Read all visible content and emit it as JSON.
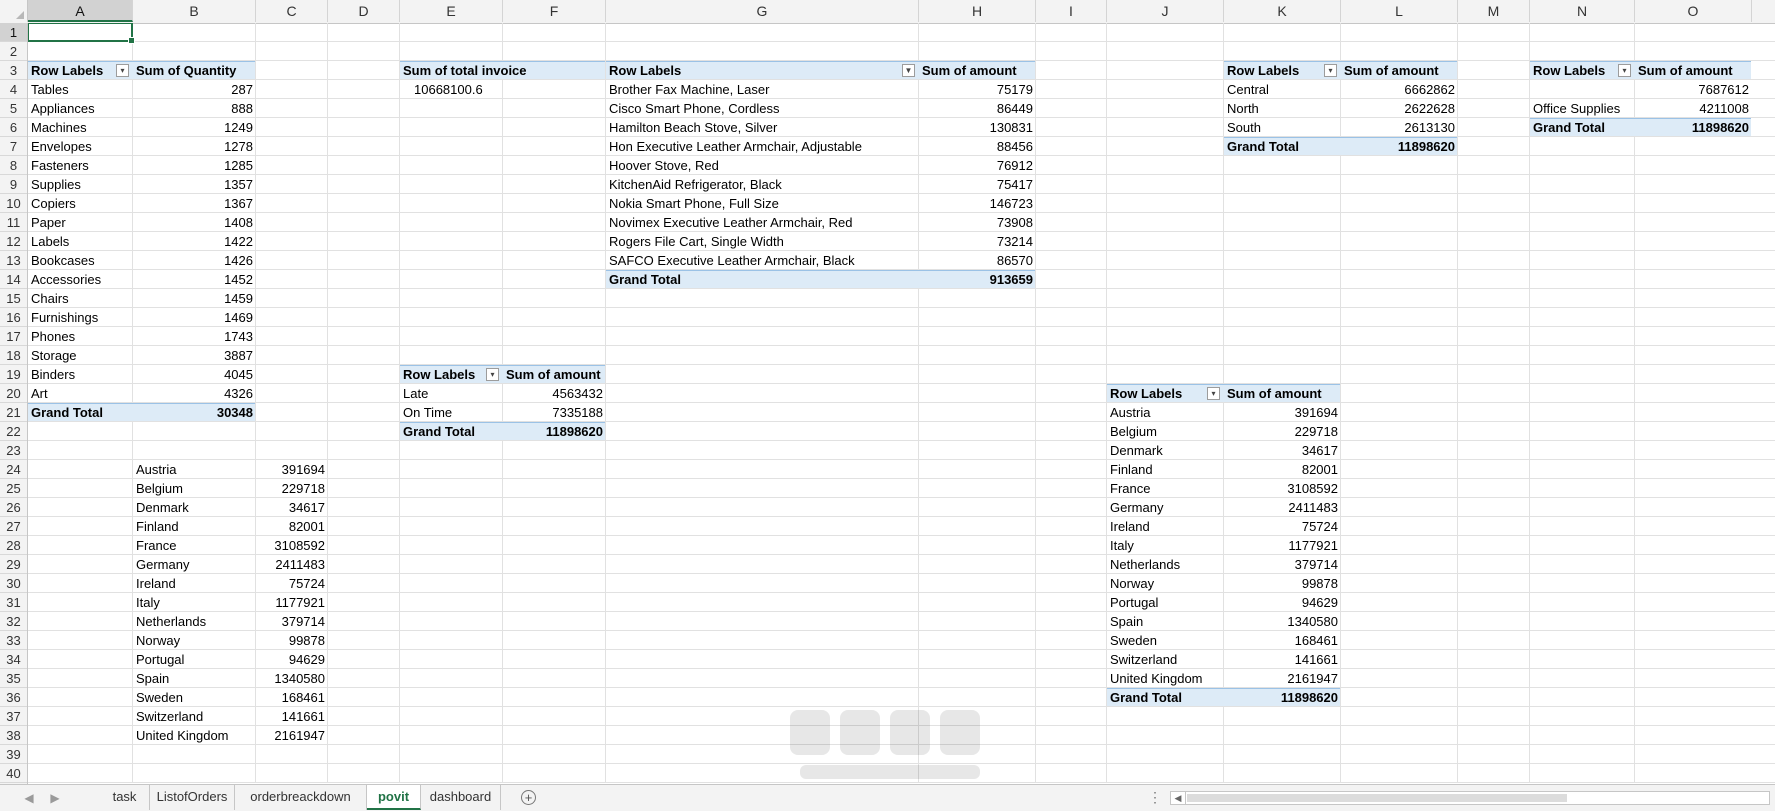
{
  "columns": [
    "A",
    "B",
    "C",
    "D",
    "E",
    "F",
    "G",
    "H",
    "I",
    "J",
    "K",
    "L",
    "M",
    "N",
    "O"
  ],
  "rows": [
    "1",
    "2",
    "3",
    "4",
    "5",
    "6",
    "7",
    "8",
    "9",
    "10",
    "11",
    "12",
    "13",
    "14",
    "15",
    "16",
    "17",
    "18",
    "19",
    "20",
    "21",
    "22",
    "23",
    "24",
    "25",
    "26",
    "27",
    "28",
    "29",
    "30",
    "31",
    "32",
    "33",
    "34",
    "35",
    "36",
    "37",
    "38",
    "39",
    "40"
  ],
  "selected_cell": "A1",
  "colors": {
    "header_band": "#ddebf7",
    "band_border": "#9bc2e6",
    "accent": "#217346"
  },
  "pivot_quantity": {
    "header": [
      "Row Labels",
      "Sum of Quantity"
    ],
    "rows": [
      [
        "Tables",
        "287"
      ],
      [
        "Appliances",
        "888"
      ],
      [
        "Machines",
        "1249"
      ],
      [
        "Envelopes",
        "1278"
      ],
      [
        "Fasteners",
        "1285"
      ],
      [
        "Supplies",
        "1357"
      ],
      [
        "Copiers",
        "1367"
      ],
      [
        "Paper",
        "1408"
      ],
      [
        "Labels",
        "1422"
      ],
      [
        "Bookcases",
        "1426"
      ],
      [
        "Accessories",
        "1452"
      ],
      [
        "Chairs",
        "1459"
      ],
      [
        "Furnishings",
        "1469"
      ],
      [
        "Phones",
        "1743"
      ],
      [
        "Storage",
        "3887"
      ],
      [
        "Binders",
        "4045"
      ],
      [
        "Art",
        "4326"
      ]
    ],
    "total": [
      "Grand Total",
      "30348"
    ]
  },
  "country_list": {
    "rows": [
      [
        "Austria",
        "391694"
      ],
      [
        "Belgium",
        "229718"
      ],
      [
        "Denmark",
        "34617"
      ],
      [
        "Finland",
        "82001"
      ],
      [
        "France",
        "3108592"
      ],
      [
        "Germany",
        "2411483"
      ],
      [
        "Ireland",
        "75724"
      ],
      [
        "Italy",
        "1177921"
      ],
      [
        "Netherlands",
        "379714"
      ],
      [
        "Norway",
        "99878"
      ],
      [
        "Portugal",
        "94629"
      ],
      [
        "Spain",
        "1340580"
      ],
      [
        "Sweden",
        "168461"
      ],
      [
        "Switzerland",
        "141661"
      ],
      [
        "United Kingdom",
        "2161947"
      ]
    ]
  },
  "invoice_total": {
    "header": "Sum of total invoice",
    "value": "10668100.6"
  },
  "pivot_status": {
    "header": [
      "Row Labels",
      "Sum of amount"
    ],
    "rows": [
      [
        "Late",
        "4563432"
      ],
      [
        "On Time",
        "7335188"
      ]
    ],
    "total": [
      "Grand Total",
      "11898620"
    ]
  },
  "pivot_products": {
    "header": [
      "Row Labels",
      "Sum of amount"
    ],
    "rows": [
      [
        "Brother Fax Machine, Laser",
        "75179"
      ],
      [
        "Cisco Smart Phone, Cordless",
        "86449"
      ],
      [
        "Hamilton Beach Stove, Silver",
        "130831"
      ],
      [
        "Hon Executive Leather Armchair, Adjustable",
        "88456"
      ],
      [
        "Hoover Stove, Red",
        "76912"
      ],
      [
        "KitchenAid Refrigerator, Black",
        "75417"
      ],
      [
        "Nokia Smart Phone, Full Size",
        "146723"
      ],
      [
        "Novimex Executive Leather Armchair, Red",
        "73908"
      ],
      [
        "Rogers File Cart, Single Width",
        "73214"
      ],
      [
        "SAFCO Executive Leather Armchair, Black",
        "86570"
      ]
    ],
    "total": [
      "Grand Total",
      "913659"
    ]
  },
  "pivot_region": {
    "header": [
      "Row Labels",
      "Sum of amount"
    ],
    "rows": [
      [
        "Central",
        "6662862"
      ],
      [
        "North",
        "2622628"
      ],
      [
        "South",
        "2613130"
      ]
    ],
    "total": [
      "Grand Total",
      "11898620"
    ]
  },
  "pivot_category": {
    "header": [
      "Row Labels",
      "Sum of amount"
    ],
    "rows": [
      [
        "",
        "7687612"
      ],
      [
        "Office Supplies",
        "4211008"
      ]
    ],
    "total": [
      "Grand Total",
      "11898620"
    ]
  },
  "pivot_country": {
    "header": [
      "Row Labels",
      "Sum of amount"
    ],
    "rows": [
      [
        "Austria",
        "391694"
      ],
      [
        "Belgium",
        "229718"
      ],
      [
        "Denmark",
        "34617"
      ],
      [
        "Finland",
        "82001"
      ],
      [
        "France",
        "3108592"
      ],
      [
        "Germany",
        "2411483"
      ],
      [
        "Ireland",
        "75724"
      ],
      [
        "Italy",
        "1177921"
      ],
      [
        "Netherlands",
        "379714"
      ],
      [
        "Norway",
        "99878"
      ],
      [
        "Portugal",
        "94629"
      ],
      [
        "Spain",
        "1340580"
      ],
      [
        "Sweden",
        "168461"
      ],
      [
        "Switzerland",
        "141661"
      ],
      [
        "United Kingdom",
        "2161947"
      ]
    ],
    "total": [
      "Grand Total",
      "11898620"
    ]
  },
  "sheet_tabs": [
    "task",
    "ListofOrders",
    "orderbreackdown",
    "povit",
    "dashboard"
  ],
  "active_tab": "povit",
  "icons": {
    "filter": "filter-dropdown-icon",
    "filter_applied": "filter-applied-icon",
    "add_sheet": "plus-icon",
    "nav_prev": "chevron-left-icon",
    "nav_next": "chevron-right-icon"
  }
}
